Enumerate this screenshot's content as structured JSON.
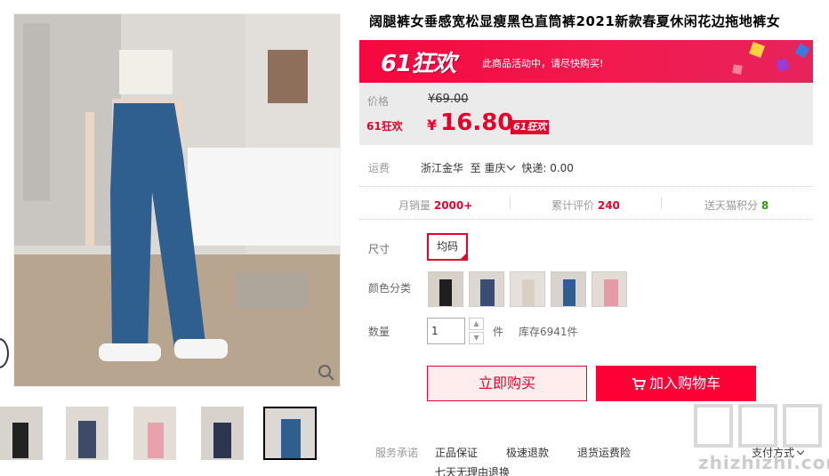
{
  "product": {
    "title": "阔腿裤女垂感宽松显瘦黑色直筒裤2021新款春夏休闲花边拖地裤女"
  },
  "promo": {
    "logo": "61狂欢",
    "text": "此商品活动中，请尽快购买!"
  },
  "price": {
    "label": "价格",
    "old": "¥69.00",
    "promo_label": "61狂欢",
    "currency": "¥",
    "current": "16.80",
    "badge": "61狂欢"
  },
  "shipping": {
    "label": "运费",
    "origin": "浙江金华",
    "to": "至",
    "destination": "重庆",
    "express": "快递: 0.00"
  },
  "stats": {
    "monthly_sales_label": "月销量",
    "monthly_sales": "2000+",
    "reviews_label": "累计评价",
    "reviews": "240",
    "points_label": "送天猫积分",
    "points": "8"
  },
  "options": {
    "size_label": "尺寸",
    "size_selected": "均码",
    "color_label": "颜色分类",
    "quantity_label": "数量",
    "quantity": "1",
    "unit": "件",
    "stock": "库存6941件"
  },
  "actions": {
    "buy_now": "立即购买",
    "add_to_cart": "加入购物车"
  },
  "services": {
    "label": "服务承诺",
    "items": [
      "正品保证",
      "极速退款",
      "退货运费险",
      "七天无理由退换"
    ],
    "pay_method": "支付方式"
  },
  "watermark": "zhizhizhi.com",
  "colors": {
    "accent": "#e4002b",
    "cart": "#ff0036",
    "pants_blue": "#2f5f8f"
  }
}
